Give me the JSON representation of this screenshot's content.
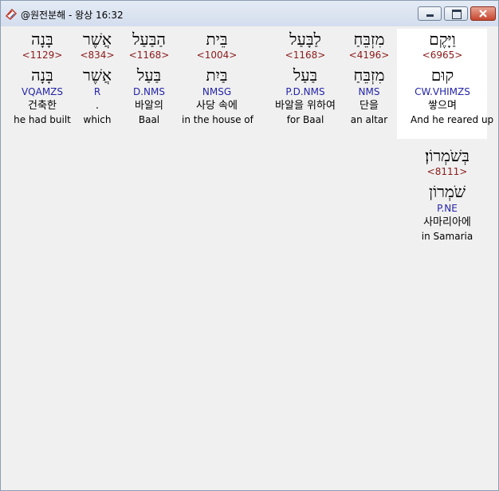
{
  "window": {
    "title": "@원전분해 - 왕상 16:32"
  },
  "words": [
    {
      "hebrew": "וַיָּקֶם",
      "strong": "<6965>",
      "lemma": "קוּם",
      "morph": "CW.VHIMZS",
      "korean": "쌓으며",
      "english": "And he reared up"
    },
    {
      "hebrew": "מִזְבֵּחַ",
      "strong": "<4196>",
      "lemma": "מִזְבֵּחַ",
      "morph": "NMS",
      "korean": "단을",
      "english": "an altar"
    },
    {
      "hebrew": "לַבָּעַל",
      "strong": "<1168>",
      "lemma": "בַּעַל",
      "morph": "P.D.NMS",
      "korean": "바알을 위하여",
      "english": "for Baal"
    },
    {
      "hebrew": "בֵּית",
      "strong": "<1004>",
      "lemma": "בַּיִת",
      "morph": "NMSG",
      "korean": "사당 속에",
      "english": "in the house of"
    },
    {
      "hebrew": "הַבַּעַל",
      "strong": "<1168>",
      "lemma": "בַּעַל",
      "morph": "D.NMS",
      "korean": "바알의",
      "english": "Baal"
    },
    {
      "hebrew": "אֲשֶׁר",
      "strong": "<834>",
      "lemma": "אֲשֶׁר",
      "morph": "R",
      "korean": ".",
      "english": "which"
    },
    {
      "hebrew": "בָּנָה",
      "strong": "<1129>",
      "lemma": "בָּנָה",
      "morph": "VQAMZS",
      "korean": "건축한",
      "english": "he had built"
    },
    {
      "hebrew": "בְּשֹׁמְרוֹן׃",
      "strong": "<8111>",
      "lemma": "שֹׁמְרוֹן",
      "morph": "P.NE",
      "korean": "사마리아에",
      "english": "in Samaria"
    }
  ]
}
